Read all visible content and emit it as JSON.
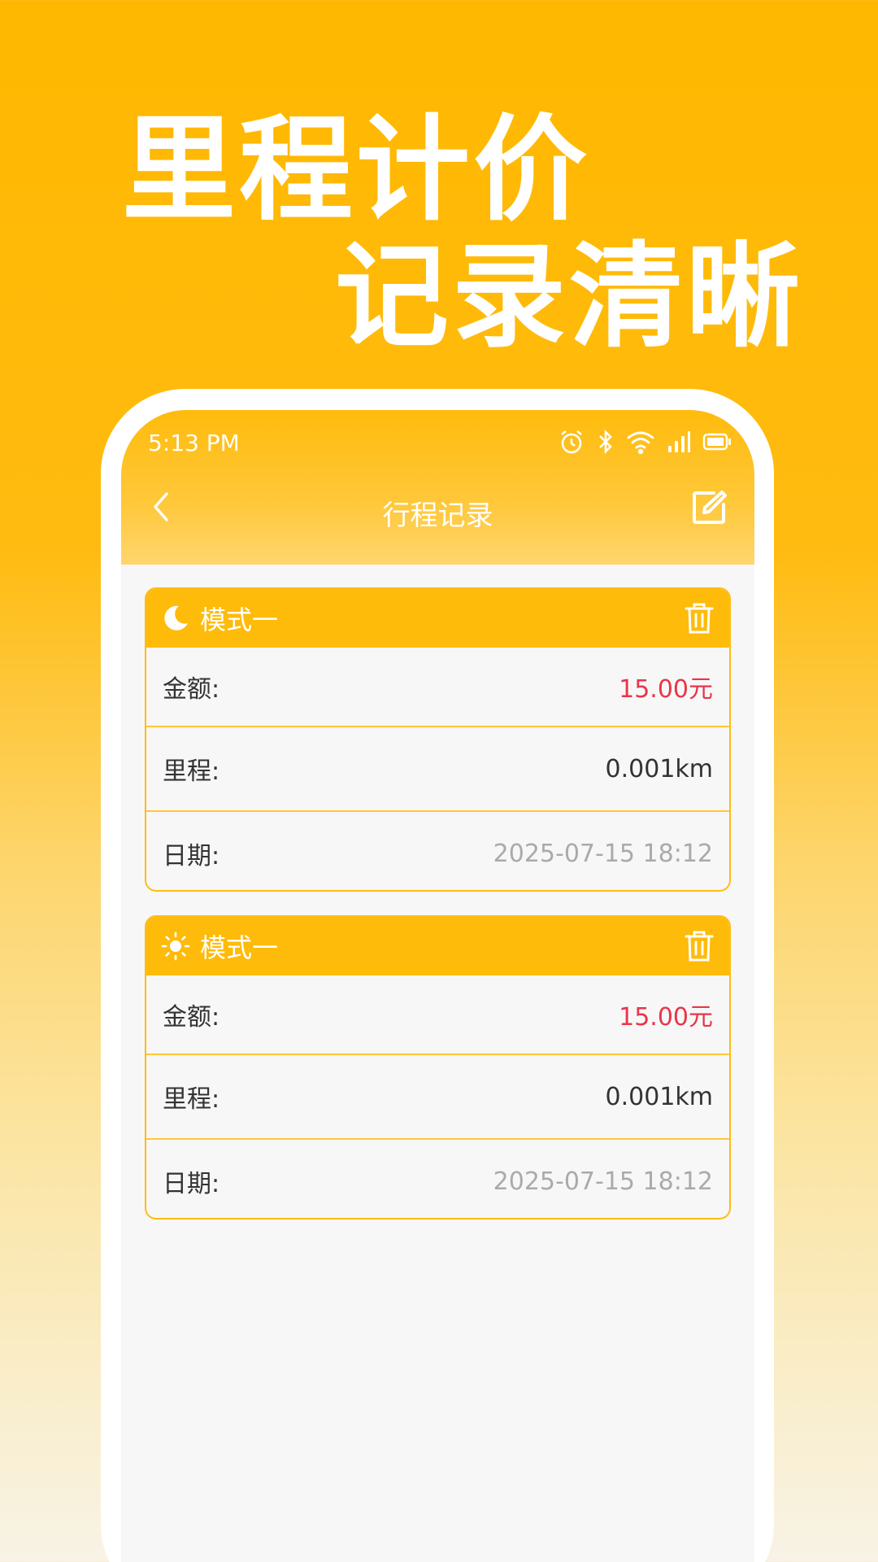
{
  "promo": {
    "line1": "里程计价",
    "line2": "记录清晰"
  },
  "status_bar": {
    "time": "5:13 PM",
    "icons": [
      "alarm-icon",
      "bluetooth-icon",
      "wifi-icon",
      "signal-icon",
      "battery-icon"
    ]
  },
  "nav": {
    "title": "行程记录",
    "back_icon": "chevron-left-icon",
    "edit_icon": "edit-icon"
  },
  "records": [
    {
      "mode_icon": "moon-icon",
      "mode": "模式一",
      "amount_label": "金额:",
      "amount": "15.00元",
      "distance_label": "里程:",
      "distance": "0.001km",
      "date_label": "日期:",
      "date": "2025-07-15 18:12"
    },
    {
      "mode_icon": "sun-icon",
      "mode": "模式一",
      "amount_label": "金额:",
      "amount": "15.00元",
      "distance_label": "里程:",
      "distance": "0.001km",
      "date_label": "日期:",
      "date": "2025-07-15 18:12"
    }
  ],
  "colors": {
    "brand": "#FFB800",
    "amount": "#E8364A",
    "date": "#AAAAAA"
  }
}
